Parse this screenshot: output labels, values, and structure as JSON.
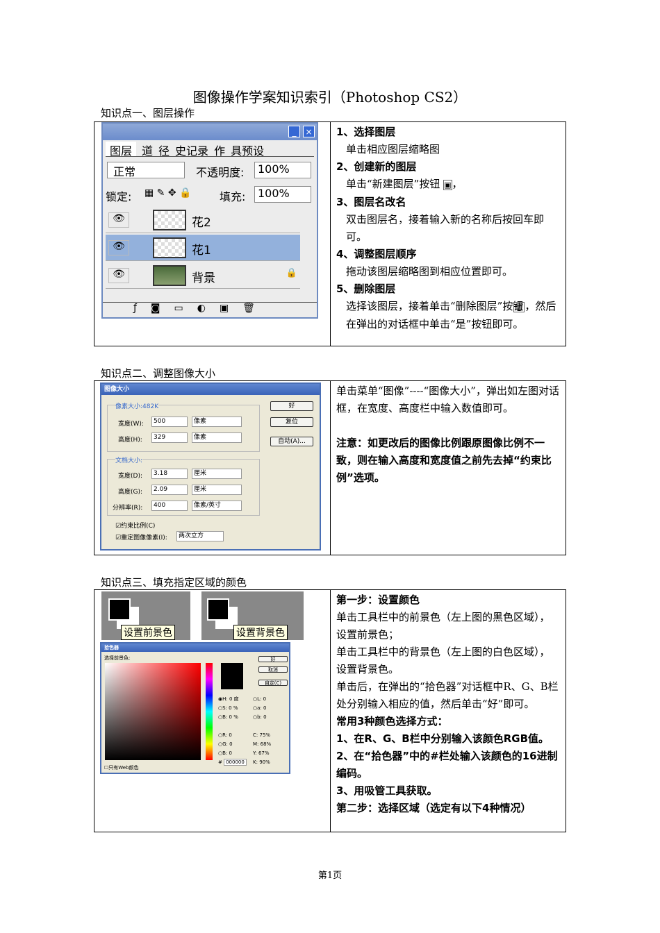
{
  "title": "图像操作学案知识索引（Photoshop CS2）",
  "sections": [
    {
      "heading": "知识点一、图层操作",
      "panel": {
        "tabs": [
          "图层",
          "道",
          "径",
          "史记录",
          "作",
          "具预设"
        ],
        "blend": "正常",
        "opacity_label": "不透明度:",
        "opacity": "100%",
        "lock_label": "锁定:",
        "fill_label": "填充:",
        "fill": "100%",
        "layers": [
          "花2",
          "花1",
          "背景"
        ],
        "minimize": "_",
        "close": "×"
      },
      "lines": [
        "1、选择图层",
        "单击相应图层缩略图",
        "2、创建新的图层",
        "单击“新建图层”按钮",
        "，",
        "3、图层名改名",
        "双击图层名，接着输入新的名称后按回车即可。",
        "4、调整图层顺序",
        "拖动该图层缩略图到相应位置即可。",
        "5、删除图层",
        "选择该图层，接着单击“删除图层”按钮",
        "，然后在弹出的对话框中单击“是”按钮即可。"
      ]
    },
    {
      "heading": "知识点二、调整图像大小",
      "dialog": {
        "title": "图像大小",
        "pixel_group": "像素大小:482K",
        "width_label": "宽度(W):",
        "width": "500",
        "px": "像素",
        "height_label": "高度(H):",
        "height": "329",
        "doc_group": "文档大小:",
        "dwidth_label": "宽度(D):",
        "dwidth": "3.18",
        "cm": "厘米",
        "dheight_label": "高度(G):",
        "dheight": "2.09",
        "res_label": "分辨率(R):",
        "res": "400",
        "res_unit": "像素/英寸",
        "constrain": "约束比例(C)",
        "resample": "重定图像像素(I):",
        "resample_method": "两次立方",
        "ok": "好",
        "reset": "复位",
        "auto": "自动(A)..."
      },
      "text1": "单击菜单“图像”----“图像大小”，弹出如左图对话框，在宽度、高度栏中输入数值即可。",
      "text2": "注意：如更改后的图像比例跟原图像比例不一致，则在输入高度和宽度值之前先去掉“约束比例”选项。"
    },
    {
      "heading": "知识点三、填充指定区域的颜色",
      "tooltip1": "设置前景色",
      "tooltip2": "设置背景色",
      "picker": {
        "title": "拾色器",
        "label": "选择前景色:",
        "ok": "好",
        "cancel": "取消",
        "custom": "自定(C)",
        "H": "0",
        "S": "0",
        "Bv": "0",
        "R": "0",
        "G": "0",
        "B": "0",
        "L": "0",
        "a": "0",
        "b": "0",
        "C": "75",
        "M": "68",
        "Y": "67",
        "K": "90",
        "hex": "000000",
        "deg": "度",
        "pct": "%",
        "web": "只有Web颜色"
      },
      "lines": [
        "第一步：设置颜色",
        "单击工具栏中的前景色（左上图的黑色区域），设置前景色；",
        "单击工具栏中的背景色（左上图的白色区域），设置背景色。",
        "单击后，在弹出的“拾色器”对话框中R、G、B栏处分别输入相应的值，然后单击“好”即可。",
        "常用3种颜色选择方式：",
        "1、在R、G、B栏中分别输入该颜色RGB值。",
        "2、在“拾色器”中的#栏处输入该颜色的16进制编码。",
        "3、用吸管工具获取。",
        "第二步：选择区域（选定有以下4种情况）"
      ]
    }
  ],
  "footer": "第1页"
}
